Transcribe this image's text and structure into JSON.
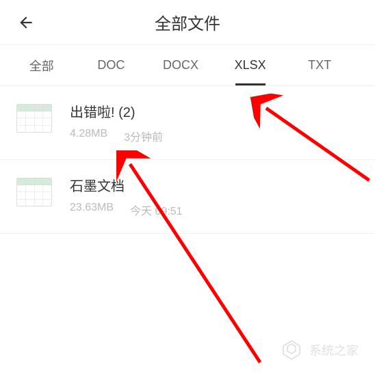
{
  "header": {
    "title": "全部文件"
  },
  "tabs": {
    "items": [
      {
        "label": "全部"
      },
      {
        "label": "DOC"
      },
      {
        "label": "DOCX"
      },
      {
        "label": "XLSX"
      },
      {
        "label": "TXT"
      }
    ],
    "activeIndex": 3
  },
  "files": [
    {
      "name": "出错啦! (2)",
      "size": "4.28MB",
      "time": "3分钟前"
    },
    {
      "name": "石墨文档",
      "size": "23.63MB",
      "time": "今天 09:51"
    }
  ],
  "watermark": {
    "text": "系统之家"
  }
}
